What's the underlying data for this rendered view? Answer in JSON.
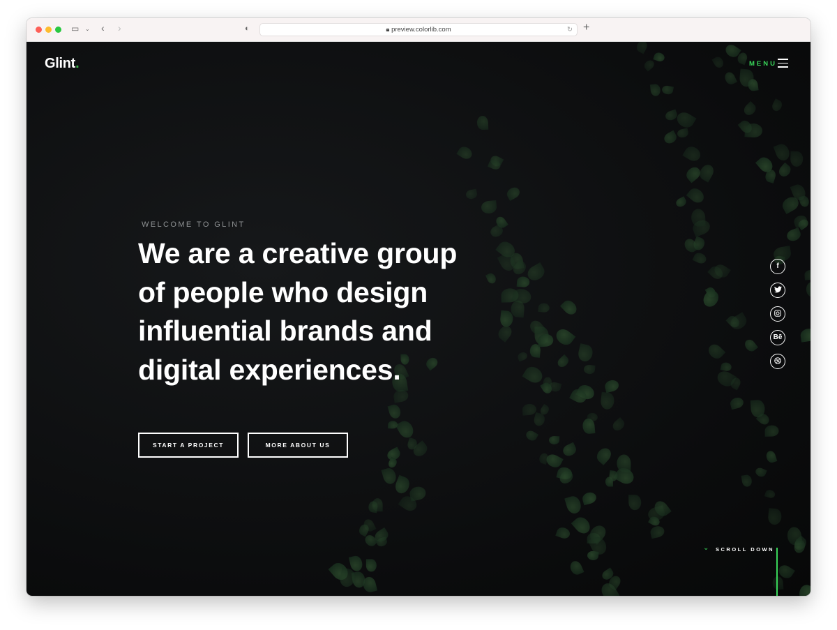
{
  "browser": {
    "url": "preview.colorlib.com"
  },
  "nav": {
    "logo": "Glint",
    "logo_dot": ".",
    "menu_label": "MENU"
  },
  "hero": {
    "pretitle": "WELCOME TO GLINT",
    "headline_lines": [
      "We are a creative group",
      "of people who design",
      "influential brands and",
      "digital experiences."
    ],
    "buttons": [
      {
        "label": "START A PROJECT"
      },
      {
        "label": "MORE ABOUT US"
      }
    ]
  },
  "social": [
    {
      "icon": "facebook-icon",
      "glyph": "f"
    },
    {
      "icon": "twitter-icon",
      "glyph": "t"
    },
    {
      "icon": "instagram-icon",
      "glyph": ""
    },
    {
      "icon": "behance-icon",
      "glyph": "Bē"
    },
    {
      "icon": "dribbble-icon",
      "glyph": ""
    }
  ],
  "scroll": {
    "label": "SCROLL DOWN"
  },
  "colors": {
    "accent": "#39d65a",
    "background": "#0b0c0d"
  }
}
